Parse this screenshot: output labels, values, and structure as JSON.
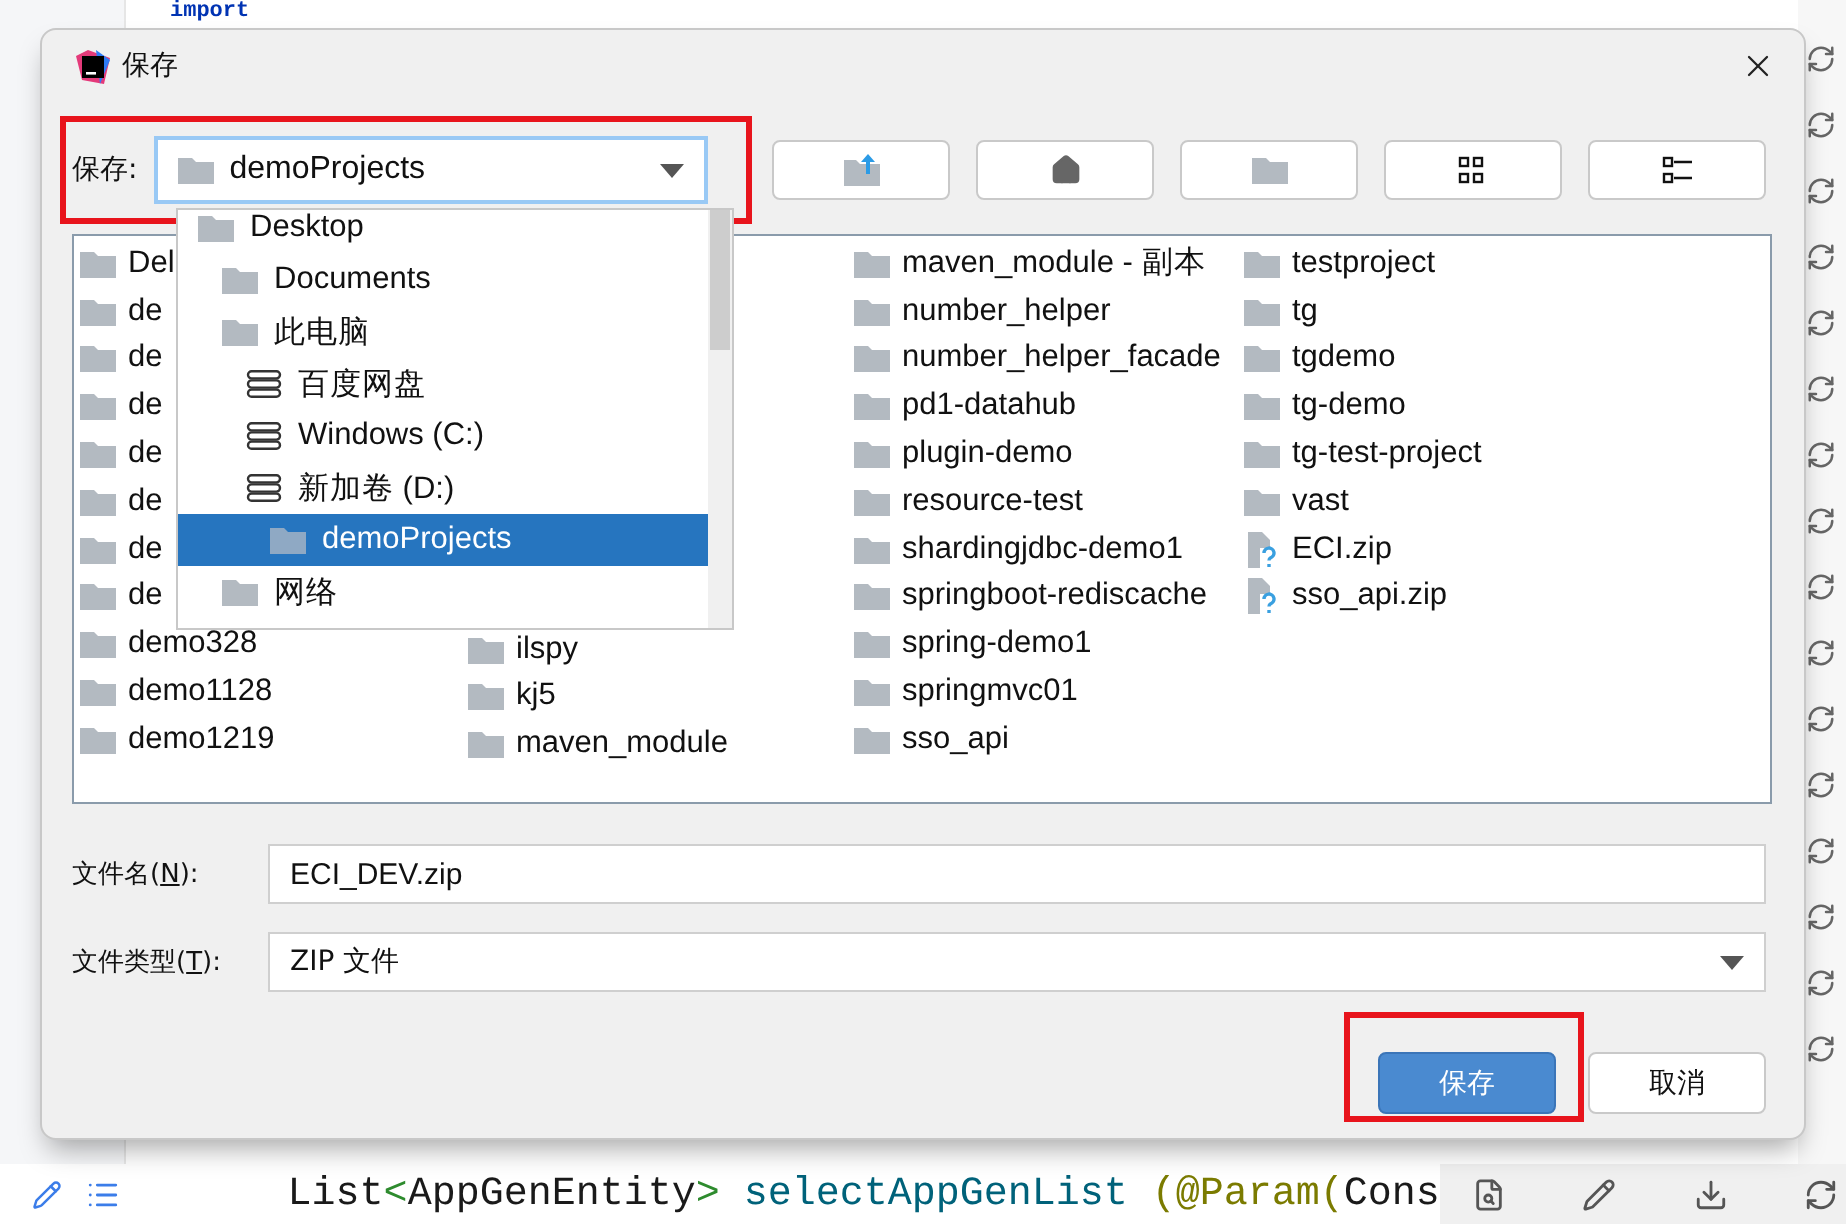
{
  "editor": {
    "top_line": "import",
    "bottom_line": [
      {
        "text": "List",
        "kind": "plain"
      },
      {
        "text": "<",
        "kind": "punct"
      },
      {
        "text": "AppGenEntity",
        "kind": "plain"
      },
      {
        "text": "> ",
        "kind": "punct"
      },
      {
        "text": "selectAppGenList ",
        "kind": "method"
      },
      {
        "text": "(@Param(",
        "kind": "annotation"
      },
      {
        "text": "Cons",
        "kind": "plain"
      }
    ]
  },
  "dialog": {
    "title": "保存",
    "location": {
      "label": "保存:",
      "value": "demoProjects",
      "highlighted": true
    },
    "toolbar": [
      {
        "kind": "up"
      },
      {
        "kind": "home"
      },
      {
        "kind": "folder"
      },
      {
        "kind": "icons"
      },
      {
        "kind": "list"
      }
    ],
    "dropdown": {
      "items": [
        {
          "name": "Desktop",
          "kind": "folder",
          "selected": false,
          "children": [
            {
              "name": "Documents",
              "kind": "folder",
              "selected": false
            },
            {
              "name": "此电脑",
              "kind": "folder",
              "selected": false,
              "children": [
                {
                  "name": "百度网盘",
                  "kind": "drive",
                  "selected": false
                },
                {
                  "name": "Windows (C:)",
                  "kind": "drive",
                  "selected": false
                },
                {
                  "name": "新加卷 (D:)",
                  "kind": "drive",
                  "selected": false,
                  "children": [
                    {
                      "name": "demoProjects",
                      "kind": "folder",
                      "selected": true
                    }
                  ]
                }
              ]
            },
            {
              "name": "网络",
              "kind": "folder",
              "selected": false
            }
          ]
        }
      ]
    },
    "file_list": {
      "columns": [
        [
          {
            "name": "Del",
            "kind": "folder"
          },
          {
            "name": "de",
            "kind": "folder"
          },
          {
            "name": "de",
            "kind": "folder"
          },
          {
            "name": "de",
            "kind": "folder"
          },
          {
            "name": "de",
            "kind": "folder"
          },
          {
            "name": "de",
            "kind": "folder"
          },
          {
            "name": "de",
            "kind": "folder"
          },
          {
            "name": "de",
            "kind": "folder"
          },
          {
            "name": "demo328",
            "kind": "folder"
          },
          {
            "name": "demo1128",
            "kind": "folder"
          },
          {
            "name": "demo1219",
            "kind": "folder"
          }
        ],
        [
          {
            "name": "ilspy",
            "kind": "folder"
          },
          {
            "name": "kj5",
            "kind": "folder"
          },
          {
            "name": "maven_module",
            "kind": "folder"
          }
        ],
        [
          {
            "name": "maven_module - 副本",
            "kind": "folder"
          },
          {
            "name": "number_helper",
            "kind": "folder"
          },
          {
            "name": "number_helper_facade",
            "kind": "folder"
          },
          {
            "name": "pd1-datahub",
            "kind": "folder"
          },
          {
            "name": "plugin-demo",
            "kind": "folder"
          },
          {
            "name": "resource-test",
            "kind": "folder"
          },
          {
            "name": "shardingjdbc-demo1",
            "kind": "folder"
          },
          {
            "name": "springboot-rediscache",
            "kind": "folder"
          },
          {
            "name": "spring-demo1",
            "kind": "folder"
          },
          {
            "name": "springmvc01",
            "kind": "folder"
          },
          {
            "name": "sso_api",
            "kind": "folder"
          }
        ],
        [
          {
            "name": "testproject",
            "kind": "folder"
          },
          {
            "name": "tg",
            "kind": "folder"
          },
          {
            "name": "tgdemo",
            "kind": "folder"
          },
          {
            "name": "tg-demo",
            "kind": "folder"
          },
          {
            "name": "tg-test-project",
            "kind": "folder"
          },
          {
            "name": "vast",
            "kind": "folder"
          },
          {
            "name": "ECI.zip",
            "kind": "file"
          },
          {
            "name": "sso_api.zip",
            "kind": "file"
          }
        ]
      ]
    },
    "file_name": {
      "label_before": "文件名(",
      "mnemonic": "N",
      "label_after": "):",
      "value": "ECI_DEV.zip"
    },
    "file_type": {
      "label_before": "文件类型(",
      "mnemonic": "T",
      "label_after": "):",
      "value": "ZIP 文件"
    },
    "buttons": [
      {
        "label": "保存",
        "primary": true,
        "highlighted": true
      },
      {
        "label": "取消",
        "primary": false,
        "highlighted": false
      }
    ]
  }
}
